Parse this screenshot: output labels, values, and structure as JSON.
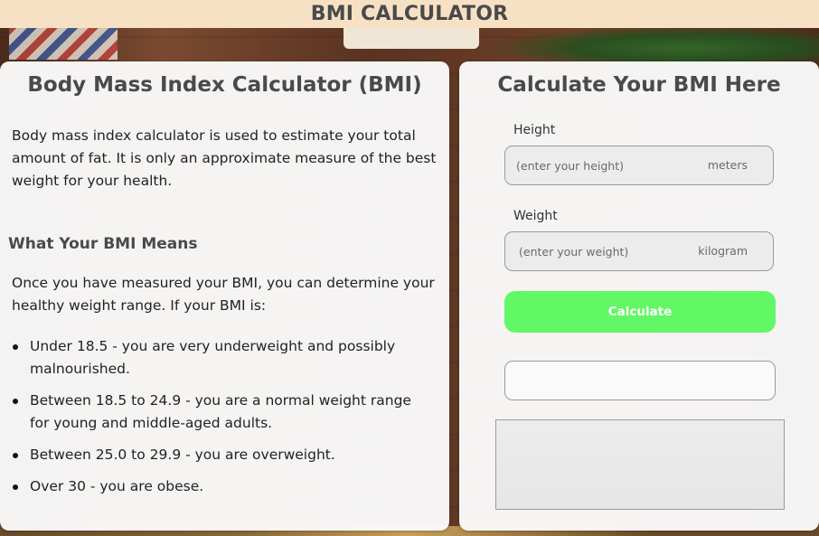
{
  "header": {
    "title": "BMI CALCULATOR"
  },
  "info_panel": {
    "title": "Body Mass Index Calculator (BMI)",
    "intro": "Body mass index calculator is used to estimate your total amount of fat. It is only an approximate measure of the best weight for your health.",
    "subheading": "What Your BMI Means",
    "lead": "Once you have measured your BMI, you can determine your healthy weight range. If your BMI is:",
    "ranges": [
      "Under 18.5 - you are very underweight and possibly malnourished.",
      "Between 18.5 to 24.9 - you are a normal weight range for young and middle-aged adults.",
      "Between 25.0 to 29.9 - you are overweight.",
      "Over 30 - you are obese."
    ]
  },
  "calculator": {
    "title": "Calculate Your BMI Here",
    "height": {
      "label": "Height",
      "value": "",
      "placeholder": "(enter your height)",
      "unit": "meters"
    },
    "weight": {
      "label": "Weight",
      "value": "",
      "placeholder": "(enter your weight)",
      "unit": "kilogram"
    },
    "button_label": "Calculate",
    "result": "",
    "message": ""
  },
  "colors": {
    "header_bg": "#f7e1c5",
    "button_bg": "#62f865",
    "panel_bg": "#fafafa"
  }
}
